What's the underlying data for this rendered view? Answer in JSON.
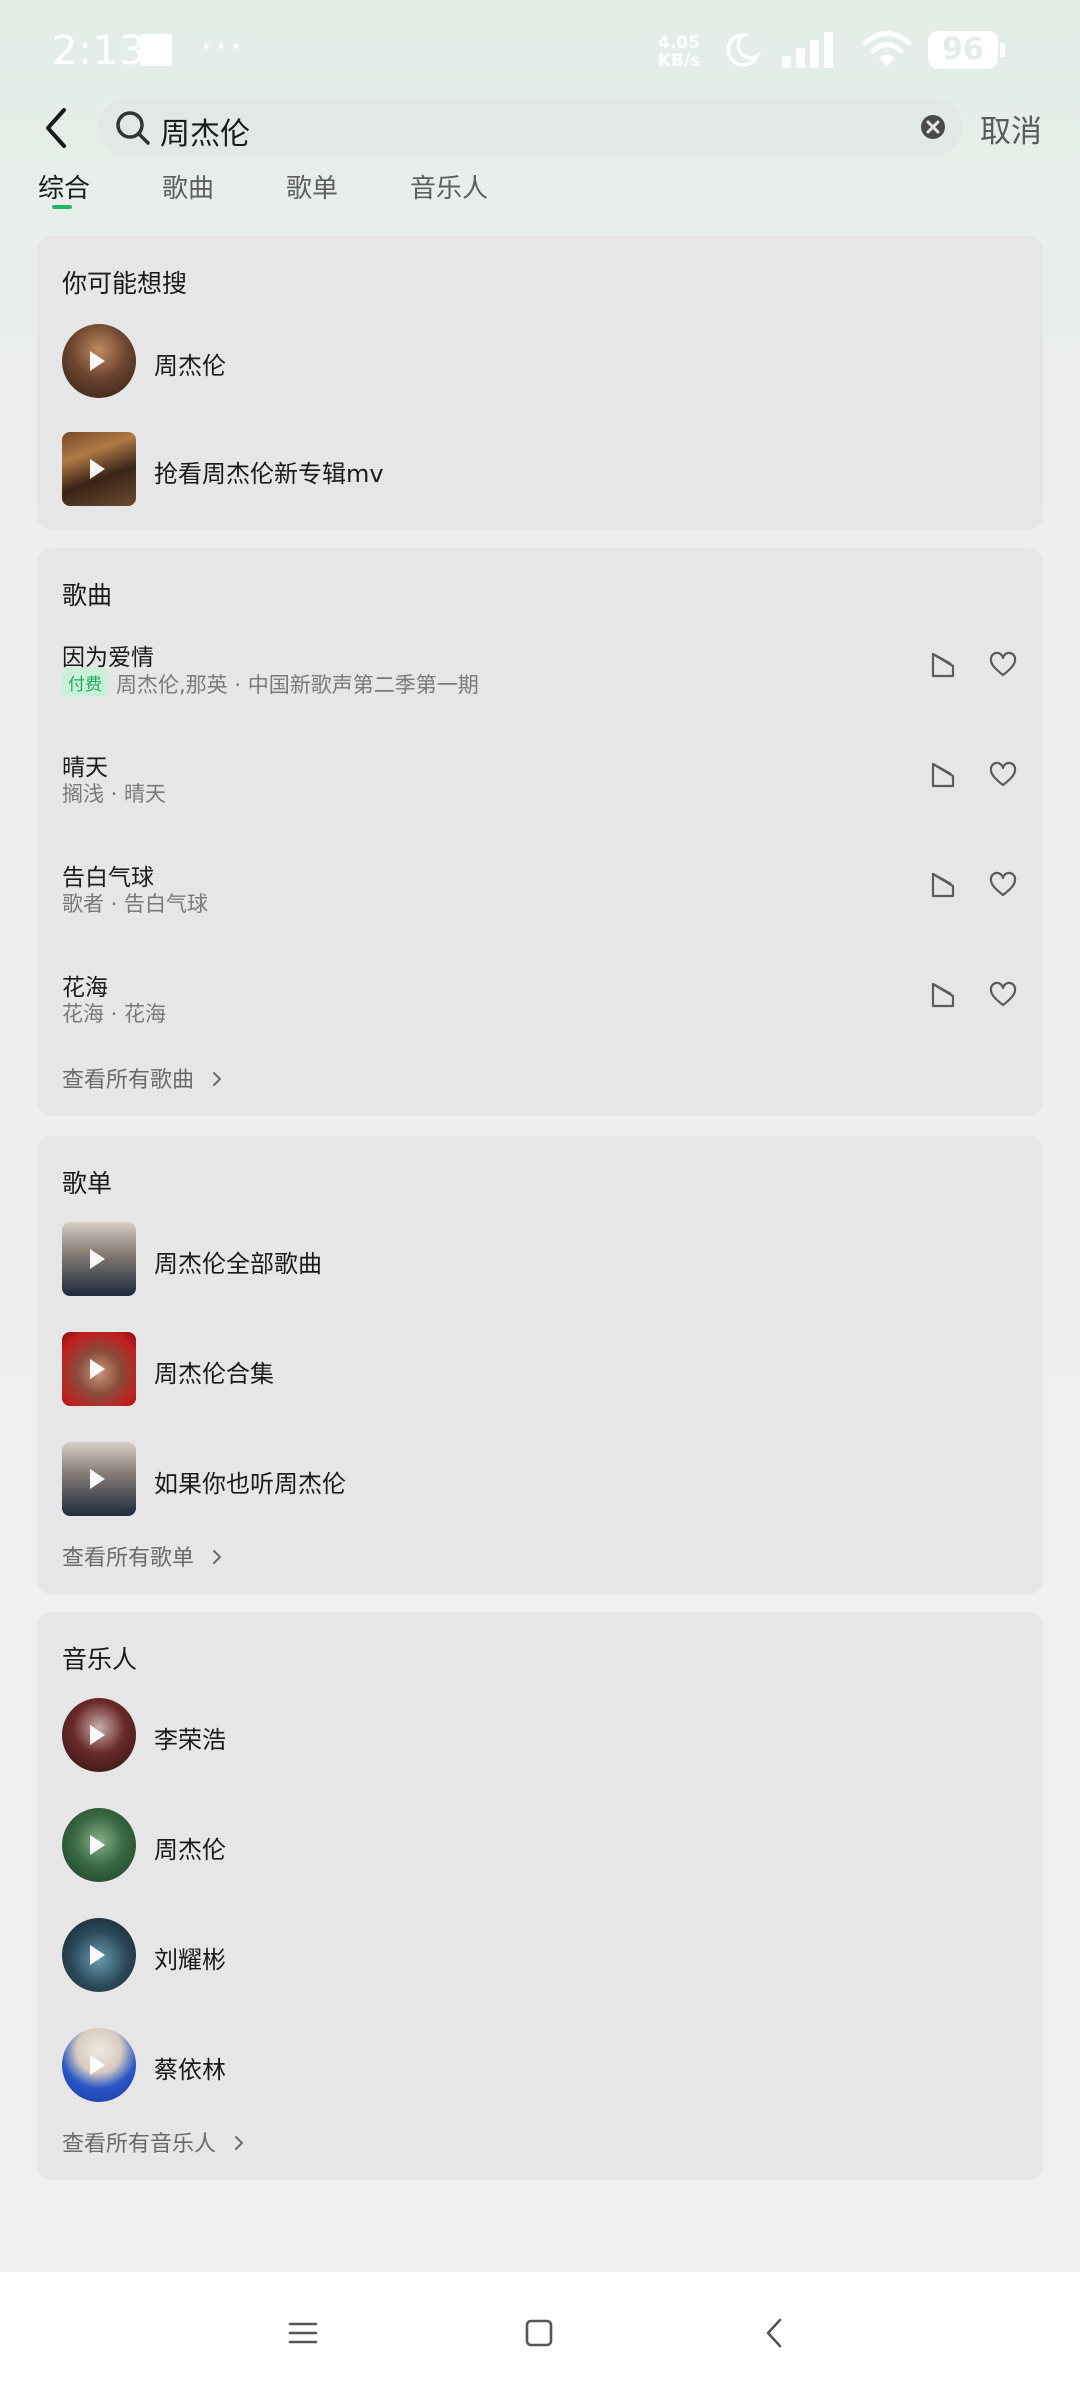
{
  "status_bar": {
    "time": "2:13",
    "net_speed_value": "4.05",
    "net_speed_unit": "KB/s",
    "battery": "96"
  },
  "search": {
    "query": "周杰伦",
    "cancel_label": "取消"
  },
  "tabs": [
    {
      "label": "综合",
      "active": true
    },
    {
      "label": "歌曲",
      "active": false
    },
    {
      "label": "歌单",
      "active": false
    },
    {
      "label": "音乐人",
      "active": false
    }
  ],
  "suggest": {
    "title": "你可能想搜",
    "items": [
      {
        "label": "周杰伦"
      },
      {
        "label": "抢看周杰伦新专辑mv"
      }
    ]
  },
  "songs": {
    "title": "歌曲",
    "items": [
      {
        "title": "因为爱情",
        "badge": "付费",
        "subtitle": "周杰伦,那英 · 中国新歌声第二季第一期"
      },
      {
        "title": "晴天",
        "badge": "",
        "subtitle": "搁浅 · 晴天"
      },
      {
        "title": "告白气球",
        "badge": "",
        "subtitle": "歌者 · 告白气球"
      },
      {
        "title": "花海",
        "badge": "",
        "subtitle": "花海 · 花海"
      }
    ],
    "see_all": "查看所有歌曲"
  },
  "playlists": {
    "title": "歌单",
    "items": [
      {
        "label": "周杰伦全部歌曲"
      },
      {
        "label": "周杰伦合集"
      },
      {
        "label": "如果你也听周杰伦"
      }
    ],
    "see_all": "查看所有歌单"
  },
  "artists": {
    "title": "音乐人",
    "items": [
      {
        "label": "李荣浩"
      },
      {
        "label": "周杰伦"
      },
      {
        "label": "刘耀彬"
      },
      {
        "label": "蔡依林"
      }
    ],
    "see_all": "查看所有音乐人"
  },
  "colors": {
    "accent": "#24b36b",
    "card_bg": "#e6e6e6",
    "paid_badge_bg": "#c9f0d8",
    "paid_badge_text": "#1faa62"
  },
  "icons": {
    "back": "chevron-left-icon",
    "search": "search-icon",
    "clear": "clear-circle-icon",
    "mv": "mv-icon",
    "favorite": "heart-icon",
    "more": "chevron-right-icon",
    "nav_menu": "menu-icon",
    "nav_home": "home-square-icon",
    "nav_back": "back-triangle-icon"
  }
}
